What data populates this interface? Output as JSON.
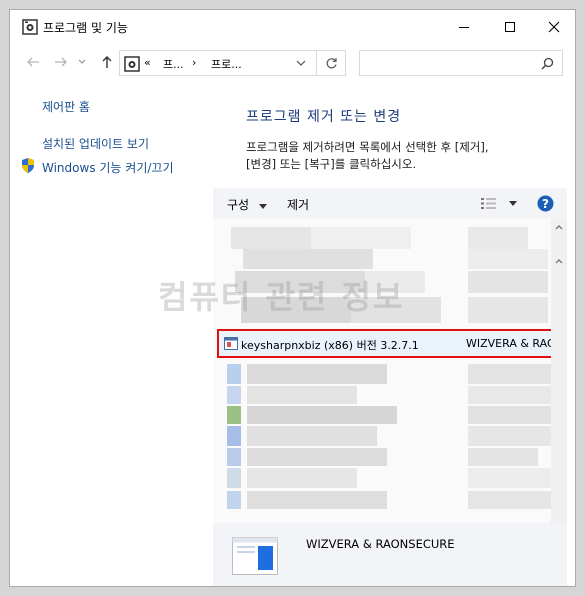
{
  "window": {
    "title": "프로그램 및 기능",
    "icon": "control-panel-icon"
  },
  "address_bar": {
    "overflow": "«",
    "crumb1": "프...",
    "sep": "›",
    "crumb2": "프로..."
  },
  "left_nav": {
    "home": "제어판 홈",
    "updates": "설치된 업데이트 보기",
    "features": "Windows 기능 켜기/끄기"
  },
  "main": {
    "title": "프로그램 제거 또는 변경",
    "desc_line1": "프로그램을 제거하려면 목록에서 선택한 후 [제거],",
    "desc_line2": "[변경] 또는 [복구]를 클릭하십시오."
  },
  "toolbar": {
    "organize": "구성",
    "uninstall": "제거"
  },
  "selected_row": {
    "name": "keysharpnxbiz (x86) 버전 3.2.7.1",
    "publisher": "WIZVERA & RAO"
  },
  "details": {
    "publisher": "WIZVERA & RAONSECURE"
  },
  "watermark": "컴퓨터 관련 정보",
  "colors": {
    "selection_border": "#e01010",
    "link": "#1a4f8f",
    "title": "#1f3d7a"
  }
}
